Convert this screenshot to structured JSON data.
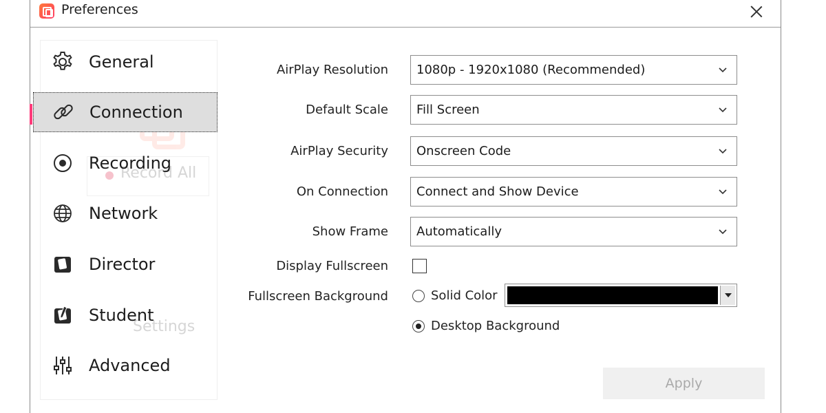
{
  "window": {
    "title": "Preferences"
  },
  "sidebar": {
    "items": [
      {
        "label": "General",
        "icon": "gear-icon"
      },
      {
        "label": "Connection",
        "icon": "link-icon",
        "selected": true
      },
      {
        "label": "Recording",
        "icon": "record-icon"
      },
      {
        "label": "Network",
        "icon": "globe-icon"
      },
      {
        "label": "Director",
        "icon": "director-icon"
      },
      {
        "label": "Student",
        "icon": "student-icon"
      },
      {
        "label": "Advanced",
        "icon": "sliders-icon"
      }
    ],
    "background_ghost": {
      "record_all": "Record All",
      "settings": "Settings"
    }
  },
  "form": {
    "airplay_resolution": {
      "label": "AirPlay Resolution",
      "value": "1080p - 1920x1080 (Recommended)"
    },
    "default_scale": {
      "label": "Default Scale",
      "value": "Fill Screen"
    },
    "airplay_security": {
      "label": "AirPlay Security",
      "value": "Onscreen Code"
    },
    "on_connection": {
      "label": "On Connection",
      "value": "Connect and Show Device"
    },
    "show_frame": {
      "label": "Show Frame",
      "value": "Automatically"
    },
    "display_fullscreen": {
      "label": "Display Fullscreen",
      "checked": false
    },
    "fullscreen_background": {
      "label": "Fullscreen Background",
      "solid_color_label": "Solid Color",
      "desktop_background_label": "Desktop Background",
      "selected": "Desktop Background",
      "color": "#000000"
    }
  },
  "footer": {
    "apply_label": "Apply"
  },
  "colors": {
    "accent": "#ff3a7a",
    "selected_bg": "#dedede",
    "disabled_text": "#a9a9a9"
  }
}
